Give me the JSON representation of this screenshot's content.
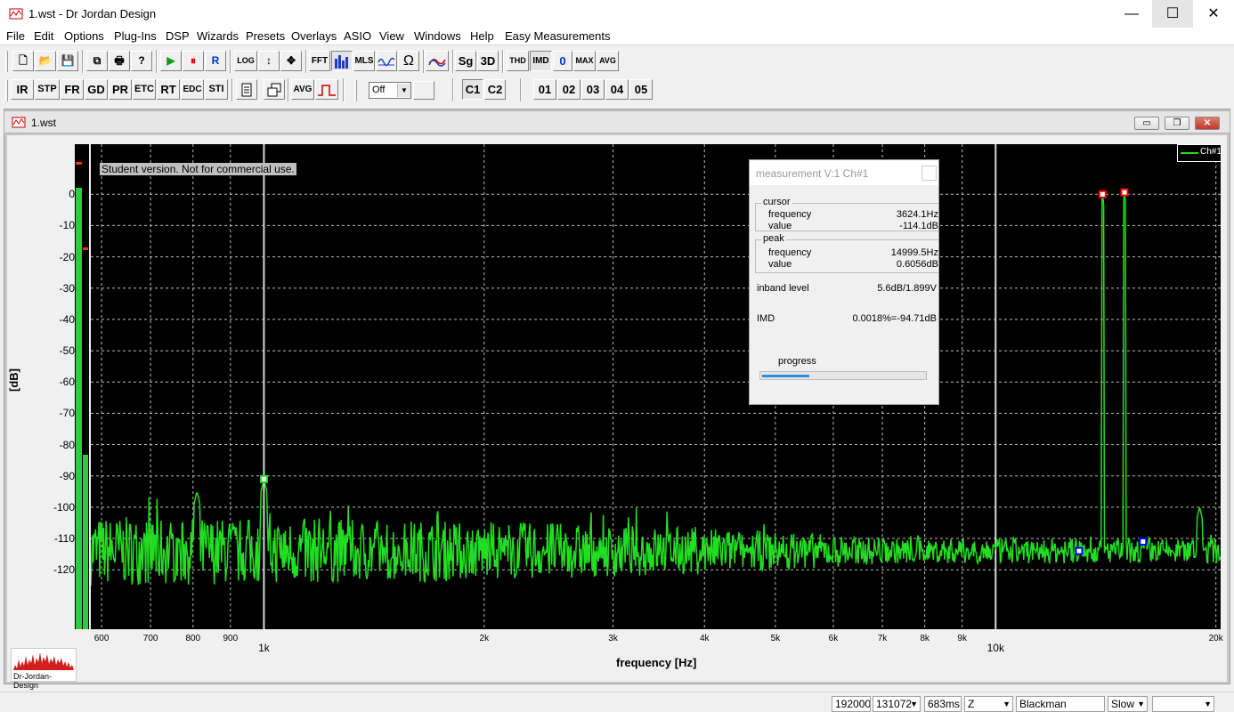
{
  "window": {
    "title": "1.wst - Dr Jordan Design",
    "min": "—",
    "max": "☐",
    "close": "✕"
  },
  "menu": [
    "File",
    "Edit",
    "Options",
    "Plug-Ins",
    "DSP",
    "Wizards",
    "Presets",
    "Overlays",
    "ASIO",
    "View",
    "Windows",
    "Help",
    "Easy Measurements"
  ],
  "toolbar1": {
    "new": "🗋",
    "open": "📂",
    "save": "💾",
    "copy": "⧉",
    "print": "🖶",
    "help": "?",
    "play": "▶",
    "pause": "⏸",
    "record": "R",
    "log": "LOG",
    "vscale": "↕",
    "move": "✥",
    "fft": "FFT",
    "mls": "MLS",
    "ohm": "Ω",
    "sg": "Sg",
    "d3": "3D",
    "thd": "THD",
    "imd": "IMD",
    "zero": "0",
    "max": "MAX",
    "avg": "AVG"
  },
  "toolbar2": {
    "buttons": [
      "IR",
      "STP",
      "FR",
      "GD",
      "PR",
      "ETC",
      "RT",
      "EDC",
      "STI"
    ],
    "avg": "AVG",
    "select_value": "Off",
    "channels": [
      "C1",
      "C2"
    ],
    "overlays": [
      "01",
      "02",
      "03",
      "04",
      "05"
    ]
  },
  "child": {
    "title": "1.wst",
    "min": "▭",
    "restore": "❐",
    "close": "✕"
  },
  "plot": {
    "watermark": "Student version. Not for commercial use.",
    "legend": "Ch#1",
    "logo_text": "Dr-Jordan-Design",
    "colors": {
      "trace": "#22dd22",
      "background": "#000000",
      "grid": "#bbbbbb",
      "marker_red": "#ff0000",
      "marker_blue": "#0000ff"
    }
  },
  "chart_data": {
    "type": "line",
    "title": "",
    "xlabel": "frequency [Hz]",
    "ylabel": "[dB]",
    "xscale": "log",
    "xlim": [
      580,
      20300
    ],
    "ylim": [
      -139,
      16
    ],
    "x_ticks": [
      "600",
      "700",
      "800",
      "900",
      "1k",
      "2k",
      "3k",
      "4k",
      "5k",
      "6k",
      "7k",
      "8k",
      "9k",
      "10k",
      "20k"
    ],
    "y_ticks": [
      "0",
      "-10",
      "-20",
      "-30",
      "-40",
      "-50",
      "-60",
      "-70",
      "-80",
      "-90",
      "-100",
      "-110",
      "-120"
    ],
    "grid": true,
    "series": [
      {
        "name": "Ch#1",
        "noise_floor_db": -114,
        "peaks": [
          {
            "x": 810,
            "y": -95
          },
          {
            "x": 1000,
            "y": -91
          },
          {
            "x": 14000,
            "y": 0
          },
          {
            "x": 14999.5,
            "y": 0.6056
          },
          {
            "x": 19000,
            "y": -100
          }
        ]
      }
    ],
    "markers": [
      {
        "x": 1000,
        "y": -91,
        "color": "green"
      },
      {
        "x": 14000,
        "y": 0,
        "color": "red"
      },
      {
        "x": 14999.5,
        "y": 0.6056,
        "color": "red"
      },
      {
        "x": 13000,
        "y": -114,
        "color": "blue"
      },
      {
        "x": 15900,
        "y": -111,
        "color": "blue"
      }
    ],
    "cursor_lines_hz": [
      1000,
      10000
    ]
  },
  "level_meters": {
    "left_fill": 0.91,
    "right_fill": 0.36
  },
  "measurement": {
    "title": "measurement V:1 Ch#1",
    "cursor_group": "cursor",
    "cursor_frequency_label": "frequency",
    "cursor_frequency": "3624.1Hz",
    "cursor_value_label": "value",
    "cursor_value": "-114.1dB",
    "peak_group": "peak",
    "peak_frequency_label": "frequency",
    "peak_frequency": "14999.5Hz",
    "peak_value_label": "value",
    "peak_value": "0.6056dB",
    "inband_label": "inband level",
    "inband_value": "5.6dB/1.899V",
    "imd_label": "IMD",
    "imd_value": "0.0018%=-94.71dB",
    "progress_label": "progress",
    "progress": 0.29
  },
  "status": {
    "rate": "192000",
    "fft_size": "131072",
    "time": "683ms",
    "weighting": "Z",
    "window": "Blackman",
    "speed": "Slow",
    "extra": ""
  }
}
